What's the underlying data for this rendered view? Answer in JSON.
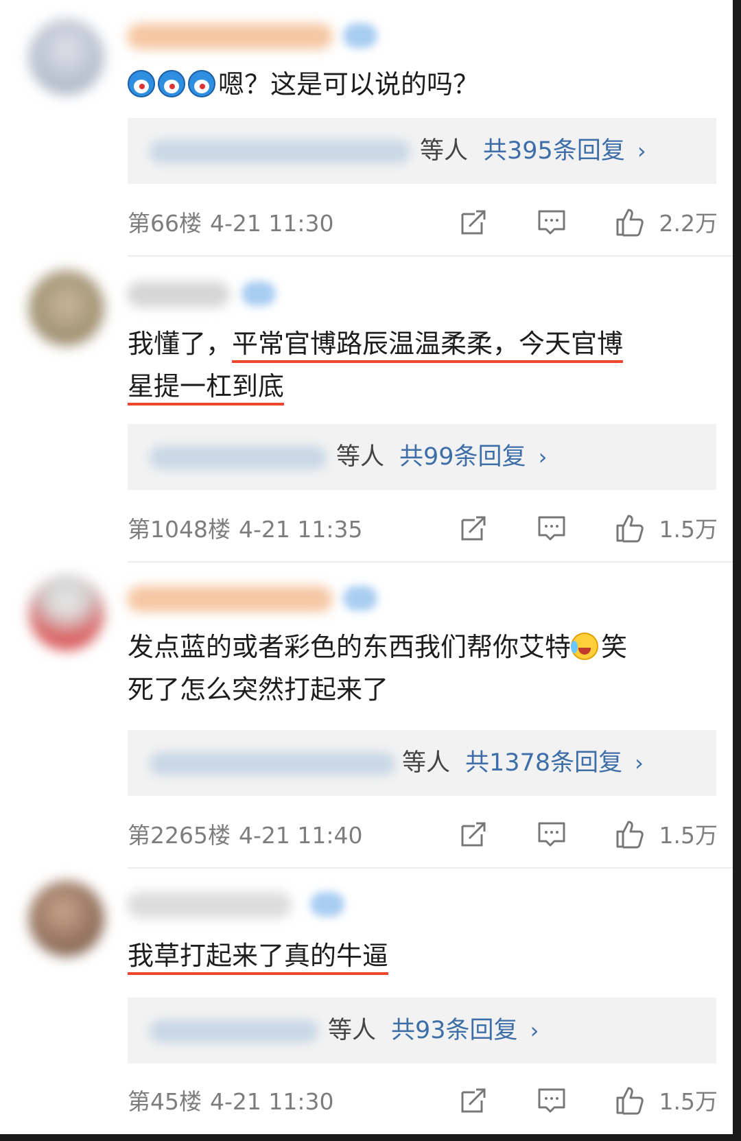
{
  "comments": [
    {
      "content": "嗯？这是可以说的吗？",
      "underlined": false,
      "reply_etc": "等人",
      "reply_count": "共395条回复",
      "floor": "第66楼",
      "time": "4-21 11:30",
      "likes": "2.2万"
    },
    {
      "content_line1": "我懂了，",
      "content_ul1": "平常官博路辰温温柔柔，今天官博",
      "content_ul2": "星提一杠到底",
      "reply_etc": "等人",
      "reply_count": "共99条回复",
      "floor": "第1048楼",
      "time": "4-21 11:35",
      "likes": "1.5万"
    },
    {
      "content_a": "发点蓝的或者彩色的东西我们帮你艾特",
      "content_b": "笑",
      "content_c": "死了怎么突然打起来了",
      "reply_etc": "等人",
      "reply_count": "共1378条回复",
      "floor": "第2265楼",
      "time": "4-21 11:40",
      "likes": "1.5万"
    },
    {
      "content": "我草打起来了真的牛逼",
      "reply_etc": "等人",
      "reply_count": "共93条回复",
      "floor": "第45楼",
      "time": "4-21 11:30",
      "likes": "1.5万"
    }
  ],
  "icons": {
    "share": "share-icon",
    "reply": "comment-icon",
    "like": "thumbs-up-icon",
    "chevron": "chevron-right-icon"
  },
  "colors": {
    "link_blue": "#3d6ea8",
    "underline_red": "#f2452f",
    "meta_gray": "#7d7d7d",
    "reply_bg": "#f2f2f2"
  }
}
